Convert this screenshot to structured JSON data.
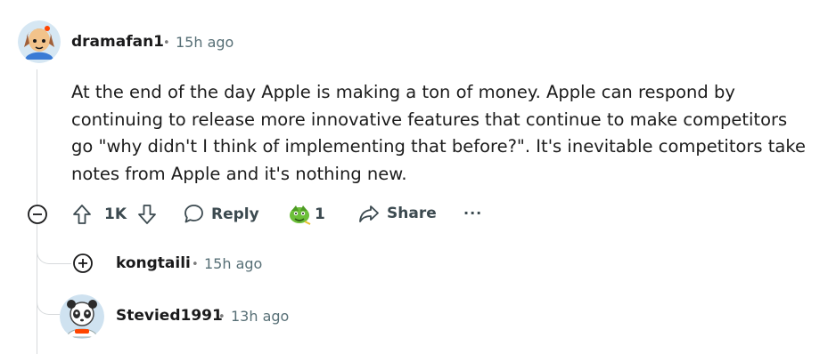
{
  "comment": {
    "author": "dramafan1",
    "time": "15h ago",
    "body": "At the end of the day Apple is making a ton of money. Apple can respond by continuing to release more innovative features that continue to make competitors go \"why didn't I think of implementing that before?\". It's inevitable competitors take notes from Apple and it's nothing new.",
    "actions": {
      "votes": "1K",
      "reply_label": "Reply",
      "award_count": "1",
      "share_label": "Share",
      "more": "···"
    }
  },
  "replies": [
    {
      "author": "kongtaili",
      "time": "15h ago",
      "collapsed": true
    },
    {
      "author": "Stevied1991",
      "time": "13h ago"
    }
  ],
  "separator": "•"
}
